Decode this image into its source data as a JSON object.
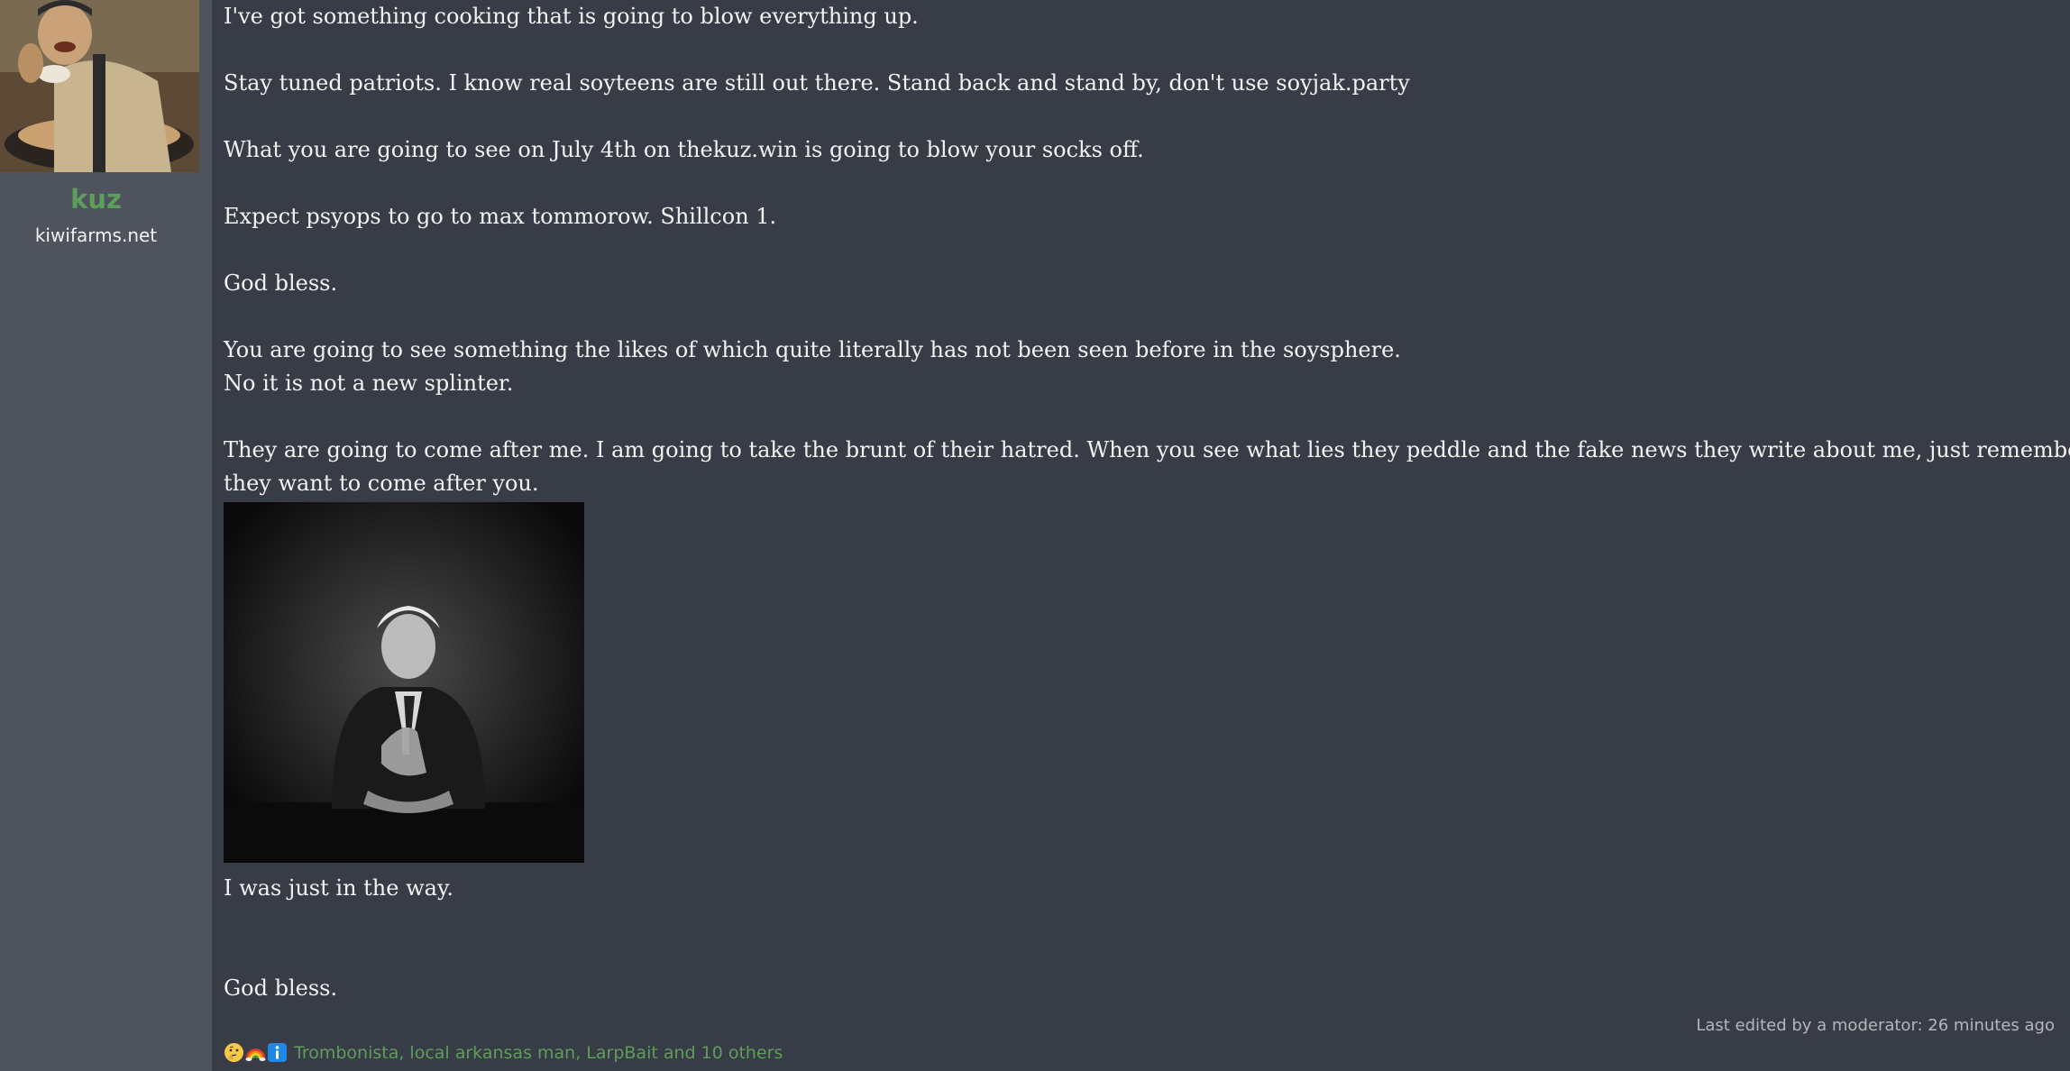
{
  "user": {
    "avatar": "user-avatar",
    "name": "kuz",
    "title": "kiwifarms.net",
    "name_color": "#5e9e5b"
  },
  "post": {
    "lines": [
      "I've got something cooking that is going to blow everything up.",
      "Stay tuned patriots. I know real soyteens are still out there. Stand back and stand by, don't use soyjak.party",
      "What you are going to see on July 4th on thekuz.win is going to blow your socks off.",
      "Expect psyops to go to max tommorow. Shillcon 1.",
      "God bless.",
      "You are going to see something the likes of which quite literally has not been seen before in the soysphere.",
      "No it is not a new splinter.",
      "They are going to come after me. I am going to take the brunt of their hatred. When you see what lies they peddle and the fake news they write about me, just remember,",
      "they want to come after you."
    ],
    "image": "post-image",
    "after_image": [
      "I was just in the way.",
      "God bless."
    ],
    "edit_note": "Last edited by a moderator: 26 minutes ago"
  },
  "reactions": {
    "icons": [
      "thinking-face-icon",
      "rainbow-icon",
      "info-icon"
    ],
    "users_text": "Trombonista, local arkansas man, LarpBait and 10 others"
  },
  "colors": {
    "background": "#383c46",
    "sidebar": "#4e535d",
    "text": "#f2f2f2",
    "accent": "#5e9e5b"
  }
}
